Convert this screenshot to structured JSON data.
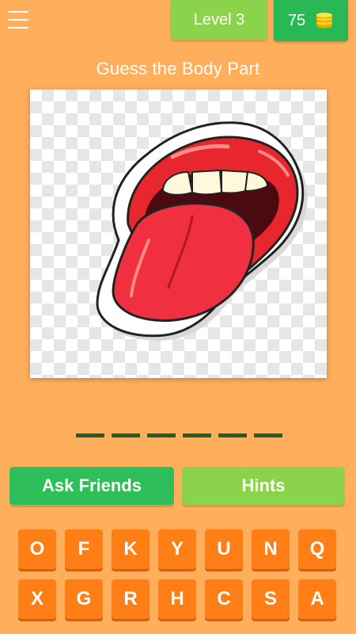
{
  "header": {
    "menu_icon": "hamburger-menu-icon",
    "level_label": "Level 3",
    "coins": "75",
    "coins_icon": "coin-stack-icon"
  },
  "question": "Guess the Body Part",
  "image": {
    "subject": "mouth-tongue-sticker"
  },
  "answer": {
    "slot_count": 6
  },
  "buttons": {
    "ask_friends": "Ask Friends",
    "hints": "Hints"
  },
  "keyboard": {
    "row1": [
      "O",
      "F",
      "K",
      "Y",
      "U",
      "N",
      "Q"
    ],
    "row2": [
      "X",
      "G",
      "R",
      "H",
      "C",
      "S",
      "A"
    ]
  },
  "colors": {
    "background": "#FFAE5C",
    "level_badge": "#8BD34A",
    "coins_badge": "#28B855",
    "key": "#FF7F16",
    "slot": "#1F5E2E"
  }
}
